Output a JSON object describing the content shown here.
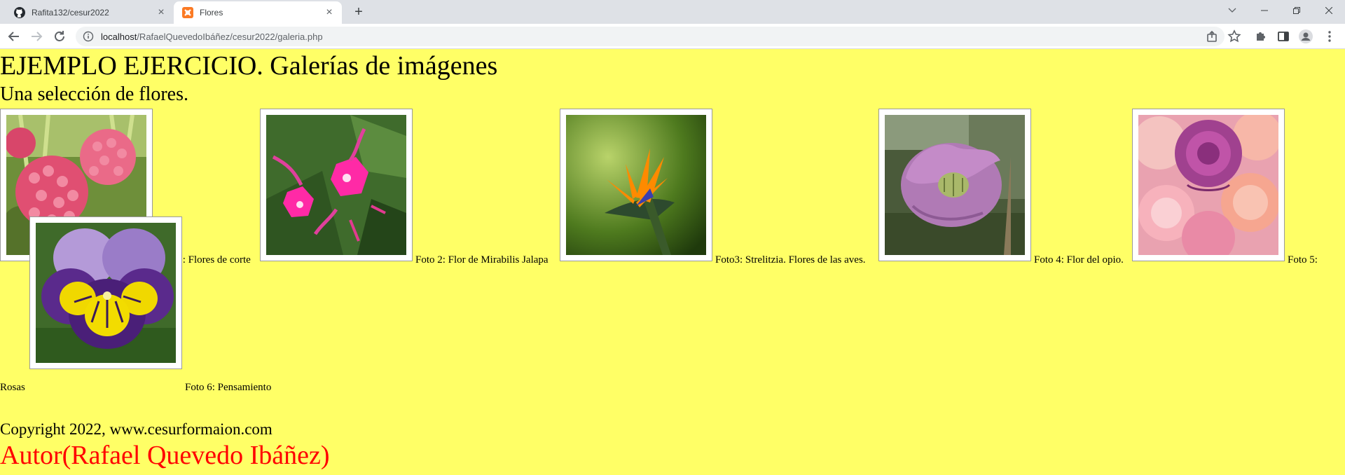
{
  "browser": {
    "tabs": [
      {
        "title": "Rafita132/cesur2022",
        "icon": "github-icon",
        "active": false
      },
      {
        "title": "Flores",
        "icon": "xampp-icon",
        "active": true
      }
    ],
    "address": {
      "host": "localhost",
      "path": "/RafaelQuevedoIbáñez/cesur2022/galeria.php"
    }
  },
  "page": {
    "title": "EJEMPLO EJERCICIO. Galerías de imágenes",
    "subtitle": "Una selección de flores.",
    "photos": [
      {
        "caption": "Foto 1: Flores de corte",
        "subject": "pink hydrangea"
      },
      {
        "caption": "Foto 2: Flor de Mirabilis Jalapa",
        "subject": "magenta mirabilis flowers"
      },
      {
        "caption": "Foto3: Strelitzia. Flores de las aves.",
        "subject": "bird of paradise flower"
      },
      {
        "caption": "Foto 4: Flor del opio.",
        "subject": "pink opium poppy"
      },
      {
        "caption_line1": "Foto 5:",
        "caption_line2": "Rosas",
        "subject": "bouquet of roses"
      },
      {
        "caption": "Foto 6: Pensamiento",
        "subject": "purple and yellow pansy"
      }
    ],
    "copyright": "Copyright 2022, www.cesurformaion.com",
    "author": "Autor(Rafael Quevedo Ibáñez)"
  },
  "colors": {
    "page_background": "#ffff66",
    "author_text": "#ff0000",
    "tabbar": "#dee1e6"
  }
}
